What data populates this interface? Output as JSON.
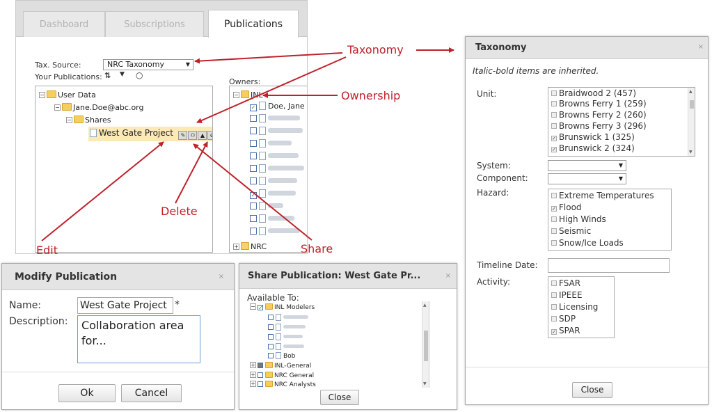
{
  "tabs": [
    "Dashboard",
    "Subscriptions",
    "Publications"
  ],
  "publications_panel": {
    "tax_source_label": "Tax. Source:",
    "tax_source_value": "NRC Taxonomy",
    "your_publications_label": "Your Publications:",
    "refresh_icon": "⇅",
    "filter_icon": "▼",
    "toggle_icon": "○",
    "tree": {
      "user_data": "User Data",
      "user": "Jane.Doe@abc.org",
      "shares": "Shares",
      "project": "West Gate Project"
    },
    "owners_label": "Owners:",
    "owners_root": "INL",
    "owner_first": "Doe, Jane",
    "owners_other_root": "NRC"
  },
  "annotations": {
    "taxonomy": "Taxonomy",
    "ownership": "Ownership",
    "delete": "Delete",
    "edit": "Edit",
    "share": "Share"
  },
  "taxonomy_dialog": {
    "title": "Taxonomy",
    "close_x": "×",
    "note": "Italic-bold items are inherited.",
    "unit_label": "Unit:",
    "units": [
      {
        "label": "Braidwood 2 (457)",
        "checked": false
      },
      {
        "label": "Browns Ferry 1 (259)",
        "checked": false
      },
      {
        "label": "Browns Ferry 2 (260)",
        "checked": false
      },
      {
        "label": "Browns Ferry 3 (296)",
        "checked": false
      },
      {
        "label": "Brunswick 1 (325)",
        "checked": true
      },
      {
        "label": "Brunswick 2 (324)",
        "checked": true
      }
    ],
    "system_label": "System:",
    "component_label": "Component:",
    "hazard_label": "Hazard:",
    "hazards": [
      {
        "label": "Extreme Temperatures",
        "checked": false
      },
      {
        "label": "Flood",
        "checked": true
      },
      {
        "label": "High Winds",
        "checked": false
      },
      {
        "label": "Seismic",
        "checked": false
      },
      {
        "label": "Snow/Ice Loads",
        "checked": false
      }
    ],
    "timeline_label": "Timeline Date:",
    "activity_label": "Activity:",
    "activities": [
      {
        "label": "FSAR",
        "checked": false
      },
      {
        "label": "IPEEE",
        "checked": false
      },
      {
        "label": "Licensing",
        "checked": false
      },
      {
        "label": "SDP",
        "checked": false
      },
      {
        "label": "SPAR",
        "checked": true
      }
    ],
    "close_button": "Close"
  },
  "modify_dialog": {
    "title": "Modify Publication",
    "close_x": "×",
    "name_label": "Name:",
    "name_value": "West Gate Project",
    "required_mark": "*",
    "description_label": "Description:",
    "description_value": "Collaboration area for...",
    "ok_button": "Ok",
    "cancel_button": "Cancel"
  },
  "share_dialog": {
    "title": "Share Publication: West Gate Pr...",
    "close_x": "×",
    "available_label": "Available To:",
    "group_inl": "INL Modelers",
    "member_bob": "Bob",
    "group_inl_general": "INL-General",
    "group_nrc_general": "NRC General",
    "group_nrc_analysts": "NRC Analysts",
    "close_button": "Close"
  },
  "colors": {
    "annotation": "#c0202a",
    "folder": "#f5cf5e",
    "dialog_header": "#e4e4e4"
  }
}
